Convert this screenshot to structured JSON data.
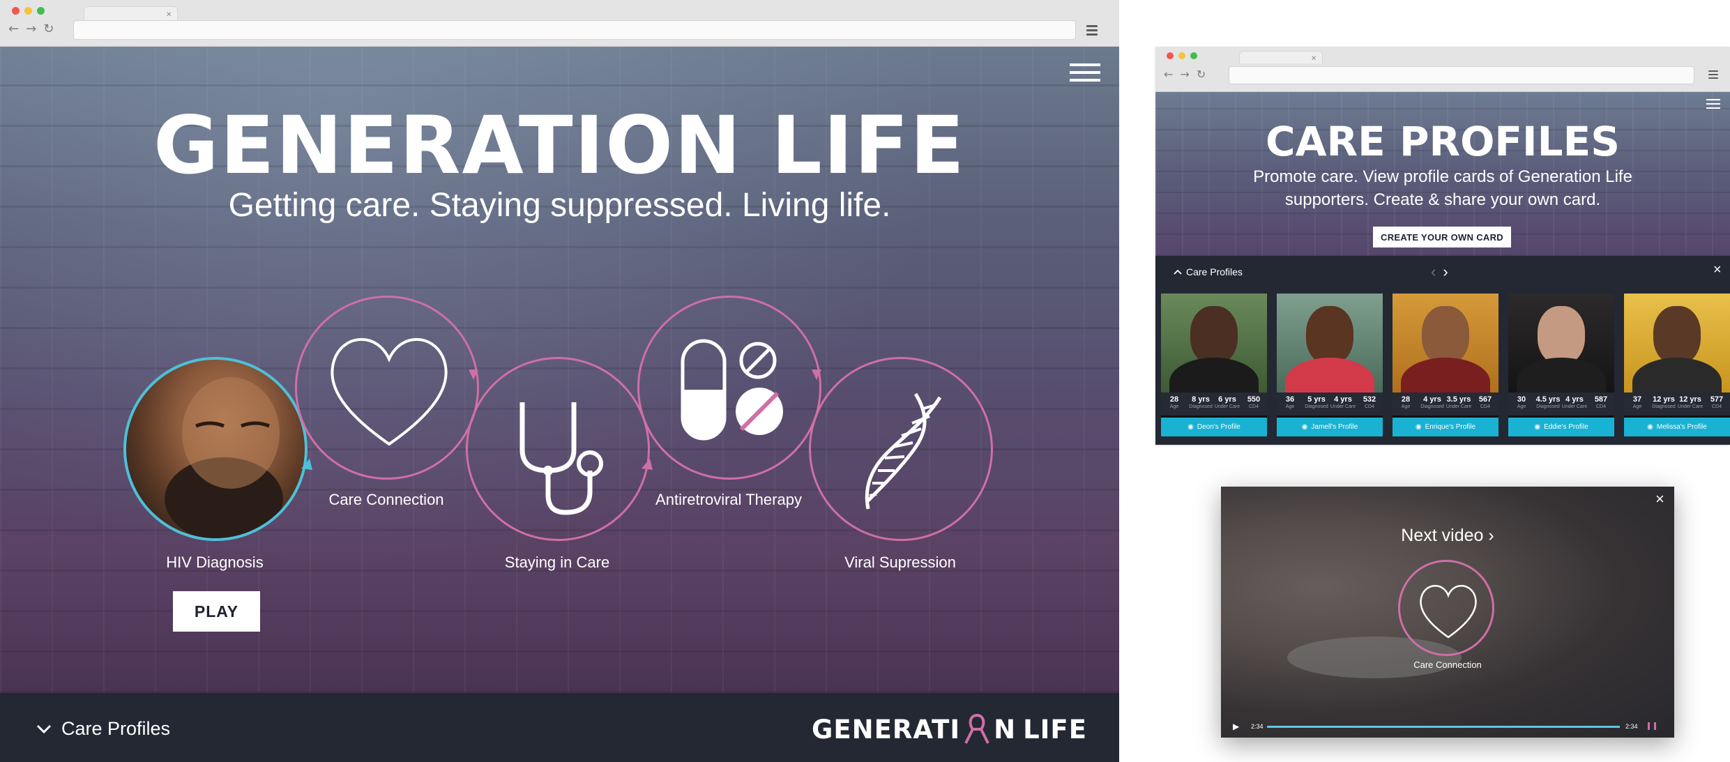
{
  "main_browser": {
    "hero": {
      "title": "GENERATION LIFE",
      "subtitle": "Getting care. Staying suppressed. Living life."
    },
    "journey": {
      "steps": [
        {
          "label": "HIV Diagnosis",
          "icon": "video-thumbnail"
        },
        {
          "label": "Care Connection",
          "icon": "heart-icon"
        },
        {
          "label": "Staying in Care",
          "icon": "stethoscope-icon"
        },
        {
          "label": "Antiretroviral Therapy",
          "icon": "pills-icon"
        },
        {
          "label": "Viral Supression",
          "icon": "dna-icon"
        }
      ],
      "play_label": "PLAY"
    },
    "footer": {
      "care_profiles_label": "Care Profiles",
      "logo_left": "GENERATI",
      "logo_mid": "N",
      "logo_right": "LIFE"
    }
  },
  "care_profiles_browser": {
    "title": "CARE PROFILES",
    "description": "Promote care. View profile cards of Generation Life supporters. Create & share your own card.",
    "create_label": "CREATE YOUR OWN CARD",
    "strip_label": "Care Profiles",
    "stat_labels": [
      "Age",
      "Diagnosed",
      "Under Care",
      "CD4"
    ],
    "cards": [
      {
        "age": "28",
        "diagnosed": "8 yrs",
        "under_care": "6 yrs",
        "cd4": "550",
        "button": "Deon's Profile"
      },
      {
        "age": "36",
        "diagnosed": "5 yrs",
        "under_care": "4 yrs",
        "cd4": "532",
        "button": "Jamell's Profile"
      },
      {
        "age": "28",
        "diagnosed": "4 yrs",
        "under_care": "3.5 yrs",
        "cd4": "567",
        "button": "Enrique's Profile"
      },
      {
        "age": "30",
        "diagnosed": "4.5 yrs",
        "under_care": "4 yrs",
        "cd4": "587",
        "button": "Eddie's Profile"
      },
      {
        "age": "37",
        "diagnosed": "12 yrs",
        "under_care": "12 yrs",
        "cd4": "577",
        "button": "Melissa's Profile"
      }
    ]
  },
  "video_overlay": {
    "next_label": "Next video ›",
    "caption": "Care Connection",
    "time_current": "2:34",
    "time_total": "2:34"
  },
  "colors": {
    "accent_pink": "#cf6fa6",
    "accent_cyan": "#19b2d3",
    "footer_dark": "#232833"
  }
}
